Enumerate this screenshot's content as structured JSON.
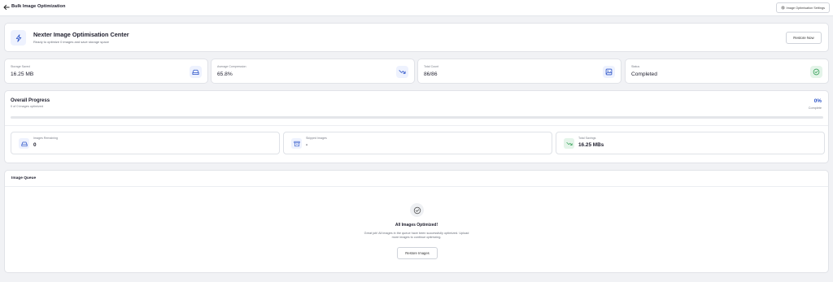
{
  "topbar": {
    "title": "Bulk Image Optimization",
    "settings_label": "Image Optimisation Settings"
  },
  "header": {
    "title": "Nexter Image Optimisation Center",
    "subtitle": "Ready to optimize 0 images and save storage space",
    "restore_now_label": "Restore Now"
  },
  "stats": [
    {
      "label": "Storage Saved",
      "value": "16.25 MB",
      "icon": "hdd-icon",
      "color": "#2d55c8"
    },
    {
      "label": "Average Compression",
      "value": "65.8%",
      "icon": "trend-down-icon",
      "color": "#2d55c8"
    },
    {
      "label": "Total Count",
      "value": "86/86",
      "icon": "image-icon",
      "color": "#2d55c8"
    },
    {
      "label": "Status",
      "value": "Completed",
      "icon": "check-circle-icon",
      "color": "#3aa35c"
    }
  ],
  "progress": {
    "title": "Overall Progress",
    "subtitle": "0 of 0 images optimized",
    "percent": "0%",
    "complete_label": "Complete",
    "fraction": 0
  },
  "mini_stats": [
    {
      "label": "Images Remaining",
      "value": "0",
      "icon": "hdd-icon"
    },
    {
      "label": "Skipped Images",
      "value": "-",
      "icon": "archive-icon"
    },
    {
      "label": "Total Savings",
      "value": "16.25 MBs",
      "icon": "trend-down-icon"
    }
  ],
  "queue": {
    "title": "Image Queue",
    "done_title": "All Images Optimized!",
    "done_text": "Great job! All images in the queue have been successfully optimized. Upload more images to continue optimizing.",
    "restore_images_label": "Restore Images"
  },
  "colors": {
    "accent": "#2d55c8",
    "success": "#3aa35c",
    "background": "#f1f2f5"
  }
}
